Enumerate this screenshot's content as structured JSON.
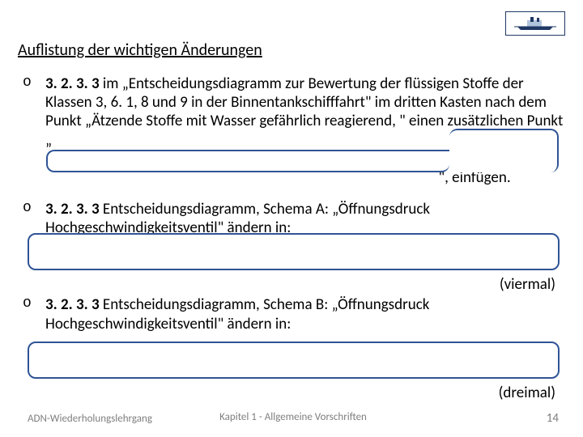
{
  "logo": {
    "alt": "ship-logo"
  },
  "heading": "Auflistung der wichtigen Änderungen",
  "items": [
    {
      "ref": "3. 2. 3. 3",
      "body": " im „Entscheidungsdiagramm zur Bewertung der flüssigen Stoffe der Klassen 3, 6. 1, 8 und 9 in der Binnentankschifffahrt\" im dritten Kasten nach dem Punkt „Ätzende Stoffe mit Wasser gefährlich reagierend, \" einen zusätzlichen Punkt „",
      "suffix": "\", einfügen."
    },
    {
      "ref": "3. 2. 3. 3",
      "body": " Entscheidungsdiagramm, Schema A: „Öffnungsdruck Hochgeschwindigkeitsventil\" ändern in:",
      "tail": "(viermal)"
    },
    {
      "ref": "3. 2. 3. 3",
      "body": " Entscheidungsdiagramm, Schema B: „Öffnungsdruck Hochgeschwindigkeitsventil\" ändern in:",
      "tail": "(dreimal)"
    }
  ],
  "footer": {
    "left": "ADN-Wiederholungslehrgang",
    "center": "Kapitel 1 - Allgemeine Vorschriften",
    "page": "14"
  }
}
